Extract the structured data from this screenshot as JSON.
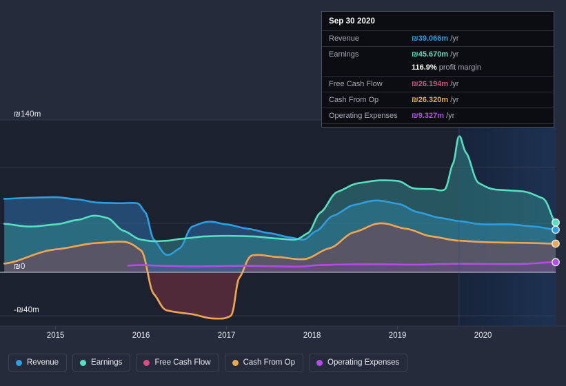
{
  "chart_data": {
    "type": "area",
    "title": "",
    "xlabel": "",
    "ylabel": "",
    "currency_symbol": "₪",
    "ylim": [
      -40,
      140
    ],
    "xlim": [
      2014.35,
      2020.85
    ],
    "grid": true,
    "y_ticks": [
      {
        "value": 140,
        "label": "₪140m"
      },
      {
        "value": 96,
        "label": ""
      },
      {
        "value": 45,
        "label": ""
      },
      {
        "value": 0,
        "label": "₪0"
      },
      {
        "value": -40,
        "label": "-₪40m"
      }
    ],
    "x_ticks": [
      {
        "value": 2015,
        "label": "2015"
      },
      {
        "value": 2016,
        "label": "2016"
      },
      {
        "value": 2017,
        "label": "2017"
      },
      {
        "value": 2018,
        "label": "2018"
      },
      {
        "value": 2019,
        "label": "2019"
      },
      {
        "value": 2020,
        "label": "2020"
      }
    ],
    "forecast_boundary_x": 2019.72,
    "legend_position": "bottom-left",
    "series": [
      {
        "name": "Revenue",
        "key": "revenue",
        "color": "#2d9ee0",
        "fill": "rgba(45,110,170,0.55)",
        "x": [
          2014.4,
          2014.7,
          2015.0,
          2015.25,
          2015.5,
          2015.75,
          2015.95,
          2016.05,
          2016.15,
          2016.3,
          2016.45,
          2016.6,
          2016.8,
          2017.0,
          2017.25,
          2017.5,
          2017.75,
          2017.9,
          2018.05,
          2018.25,
          2018.5,
          2018.75,
          2019.0,
          2019.25,
          2019.5,
          2019.72,
          2020.0,
          2020.3,
          2020.6,
          2020.85
        ],
        "y": [
          67.5,
          68.5,
          69.0,
          67.0,
          64.0,
          63.5,
          63.5,
          55.0,
          30.0,
          16.0,
          22.0,
          42.0,
          46.5,
          44.0,
          40.0,
          36.0,
          32.0,
          30.0,
          38.0,
          52.0,
          62.0,
          66.0,
          63.0,
          55.0,
          50.0,
          47.0,
          44.0,
          44.0,
          42.0,
          39.1
        ]
      },
      {
        "name": "Earnings",
        "key": "earnings",
        "color": "#55e0c0",
        "fill": "rgba(50,140,140,0.50)",
        "x": [
          2014.4,
          2014.7,
          2015.0,
          2015.25,
          2015.45,
          2015.6,
          2015.8,
          2016.0,
          2016.15,
          2016.3,
          2016.5,
          2016.75,
          2017.0,
          2017.3,
          2017.6,
          2017.8,
          2017.95,
          2018.1,
          2018.3,
          2018.55,
          2018.8,
          2019.0,
          2019.2,
          2019.4,
          2019.55,
          2019.65,
          2019.72,
          2019.8,
          2019.95,
          2020.15,
          2020.45,
          2020.7,
          2020.85
        ],
        "y": [
          44.5,
          42.0,
          44.0,
          48.0,
          52.0,
          50.0,
          38.0,
          30.0,
          28.5,
          29.0,
          31.0,
          33.0,
          33.5,
          33.0,
          31.0,
          30.0,
          36.0,
          55.0,
          74.0,
          82.0,
          84.5,
          84.0,
          77.0,
          76.5,
          76.0,
          100.0,
          125.0,
          110.0,
          82.0,
          76.0,
          74.5,
          68.0,
          45.7
        ]
      },
      {
        "name": "Free Cash Flow",
        "key": "free_cash_flow",
        "color": "#d8507f",
        "fill": "rgba(150,55,70,0.42)",
        "x": [
          2014.4,
          2015.0,
          2015.5,
          2015.8,
          2016.0,
          2016.15,
          2016.3,
          2016.55,
          2016.85,
          2017.05,
          2017.15,
          2017.3,
          2017.6,
          2017.9,
          2018.2,
          2018.5,
          2018.8,
          2019.1,
          2019.4,
          2019.72,
          2020.1,
          2020.5,
          2020.85
        ],
        "y": [
          8.0,
          21.0,
          27.0,
          28.0,
          20.0,
          -20.0,
          -35.0,
          -38.0,
          -42.5,
          -40.0,
          -5.0,
          15.5,
          14.0,
          12.0,
          22.0,
          37.0,
          45.0,
          40.0,
          33.0,
          29.0,
          27.5,
          27.0,
          26.2
        ]
      },
      {
        "name": "Cash From Op",
        "key": "cash_from_op",
        "color": "#eca74f",
        "fill": "rgba(150,110,80,0.30)",
        "x": [
          2014.4,
          2015.0,
          2015.5,
          2015.8,
          2016.0,
          2016.15,
          2016.3,
          2016.55,
          2016.85,
          2017.05,
          2017.15,
          2017.3,
          2017.6,
          2017.9,
          2018.2,
          2018.5,
          2018.8,
          2019.1,
          2019.4,
          2019.72,
          2020.1,
          2020.5,
          2020.85
        ],
        "y": [
          8.0,
          21.0,
          27.0,
          28.0,
          20.0,
          -20.0,
          -35.0,
          -38.0,
          -42.5,
          -40.0,
          -5.0,
          15.5,
          14.0,
          12.0,
          22.0,
          37.0,
          45.0,
          40.0,
          33.0,
          29.0,
          27.5,
          27.0,
          26.3
        ]
      },
      {
        "name": "Operating Expenses",
        "key": "operating_expenses",
        "color": "#b44ce8",
        "fill": "rgba(110,70,150,0.35)",
        "x": [
          2015.85,
          2016.0,
          2016.25,
          2016.55,
          2016.9,
          2017.2,
          2017.55,
          2017.85,
          2018.1,
          2018.4,
          2018.8,
          2019.2,
          2019.55,
          2019.72,
          2020.05,
          2020.4,
          2020.85
        ],
        "y": [
          6.2,
          6.6,
          6.0,
          5.4,
          5.6,
          6.0,
          5.5,
          5.2,
          6.6,
          7.2,
          7.3,
          7.0,
          7.6,
          7.8,
          7.6,
          7.5,
          9.3
        ]
      }
    ],
    "end_markers": [
      {
        "key": "earnings",
        "x": 2020.85,
        "y": 45.7,
        "color": "#55e0c0"
      },
      {
        "key": "revenue",
        "x": 2020.85,
        "y": 39.1,
        "color": "#2d9ee0"
      },
      {
        "key": "cash_from_op",
        "x": 2020.85,
        "y": 26.3,
        "color": "#eca74f"
      },
      {
        "key": "operating_expenses",
        "x": 2020.85,
        "y": 9.3,
        "color": "#b44ce8"
      }
    ]
  },
  "tooltip": {
    "date": "Sep 30 2020",
    "rows": [
      {
        "label": "Revenue",
        "value": "₪39.066m",
        "unit": "/yr",
        "color": "#2d9ee0"
      },
      {
        "label": "Earnings",
        "value": "₪45.670m",
        "unit": "/yr",
        "color": "#55e0c0"
      },
      {
        "label": "Free Cash Flow",
        "value": "₪26.194m",
        "unit": "/yr",
        "color": "#d8507f"
      },
      {
        "label": "Cash From Op",
        "value": "₪26.320m",
        "unit": "/yr",
        "color": "#eca74f"
      },
      {
        "label": "Operating Expenses",
        "value": "₪9.327m",
        "unit": "/yr",
        "color": "#b44ce8"
      }
    ],
    "profit_margin": {
      "value": "116.9%",
      "label": "profit margin"
    }
  },
  "legend": {
    "items": [
      {
        "label": "Revenue",
        "color": "#2d9ee0"
      },
      {
        "label": "Earnings",
        "color": "#55e0c0"
      },
      {
        "label": "Free Cash Flow",
        "color": "#d8507f"
      },
      {
        "label": "Cash From Op",
        "color": "#eca74f"
      },
      {
        "label": "Operating Expenses",
        "color": "#b44ce8"
      }
    ]
  },
  "theme": {
    "background": "#252b3b",
    "plot_background": "#1c2130",
    "forecast_background": "#1b2536",
    "gridline": "#3a4152",
    "zero_line": "#aab0bb",
    "text": "#e8eaed",
    "muted_text": "#a7abb6"
  }
}
